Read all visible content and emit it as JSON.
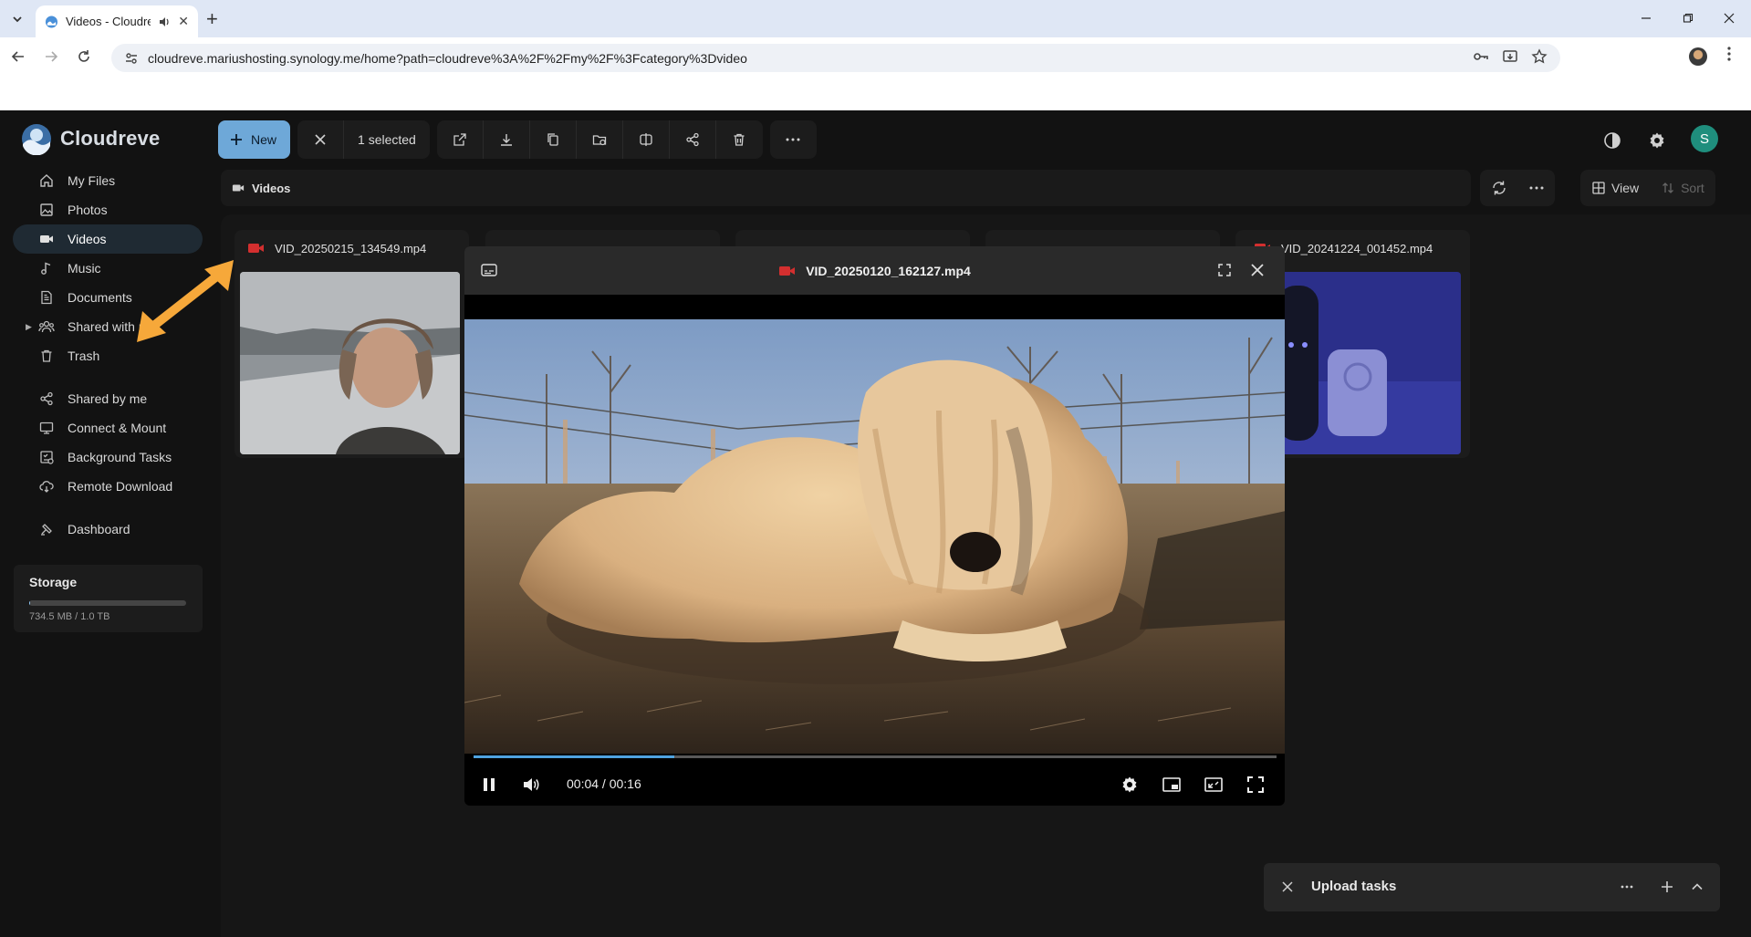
{
  "browser": {
    "tab_title": "Videos - Cloudreve",
    "url": "cloudreve.mariushosting.synology.me/home?path=cloudreve%3A%2F%2Fmy%2F%3Fcategory%3Dvideo"
  },
  "app": {
    "name": "Cloudreve",
    "accent_color": "#6ea8d8"
  },
  "sidebar": {
    "items": [
      {
        "label": "My Files",
        "icon": "home-icon"
      },
      {
        "label": "Photos",
        "icon": "image-icon"
      },
      {
        "label": "Videos",
        "icon": "video-icon",
        "active": true
      },
      {
        "label": "Music",
        "icon": "music-icon"
      },
      {
        "label": "Documents",
        "icon": "document-icon"
      },
      {
        "label": "Shared with me",
        "icon": "group-icon"
      },
      {
        "label": "Trash",
        "icon": "trash-icon"
      },
      {
        "label": "Shared by me",
        "icon": "share-icon"
      },
      {
        "label": "Connect & Mount",
        "icon": "mount-icon"
      },
      {
        "label": "Background Tasks",
        "icon": "tasks-icon"
      },
      {
        "label": "Remote Download",
        "icon": "cloud-download-icon"
      },
      {
        "label": "Dashboard",
        "icon": "dashboard-icon"
      }
    ]
  },
  "storage": {
    "title": "Storage",
    "usage_text": "734.5 MB / 1.0 TB",
    "used_fraction": 0.0007
  },
  "toolbar": {
    "new_label": "New",
    "selected_label": "1 selected"
  },
  "avatar_initial": "S",
  "breadcrumb": {
    "label": "Videos"
  },
  "view": {
    "view_label": "View",
    "sort_label": "Sort"
  },
  "files": [
    {
      "name": "VID_20250215_134549.mp4"
    },
    {
      "name": "VID_20241224_001452.mp4"
    }
  ],
  "player": {
    "title": "VID_20250120_162127.mp4",
    "timecode": "00:04 / 00:16",
    "progress": 0.25
  },
  "upload": {
    "title": "Upload tasks"
  }
}
